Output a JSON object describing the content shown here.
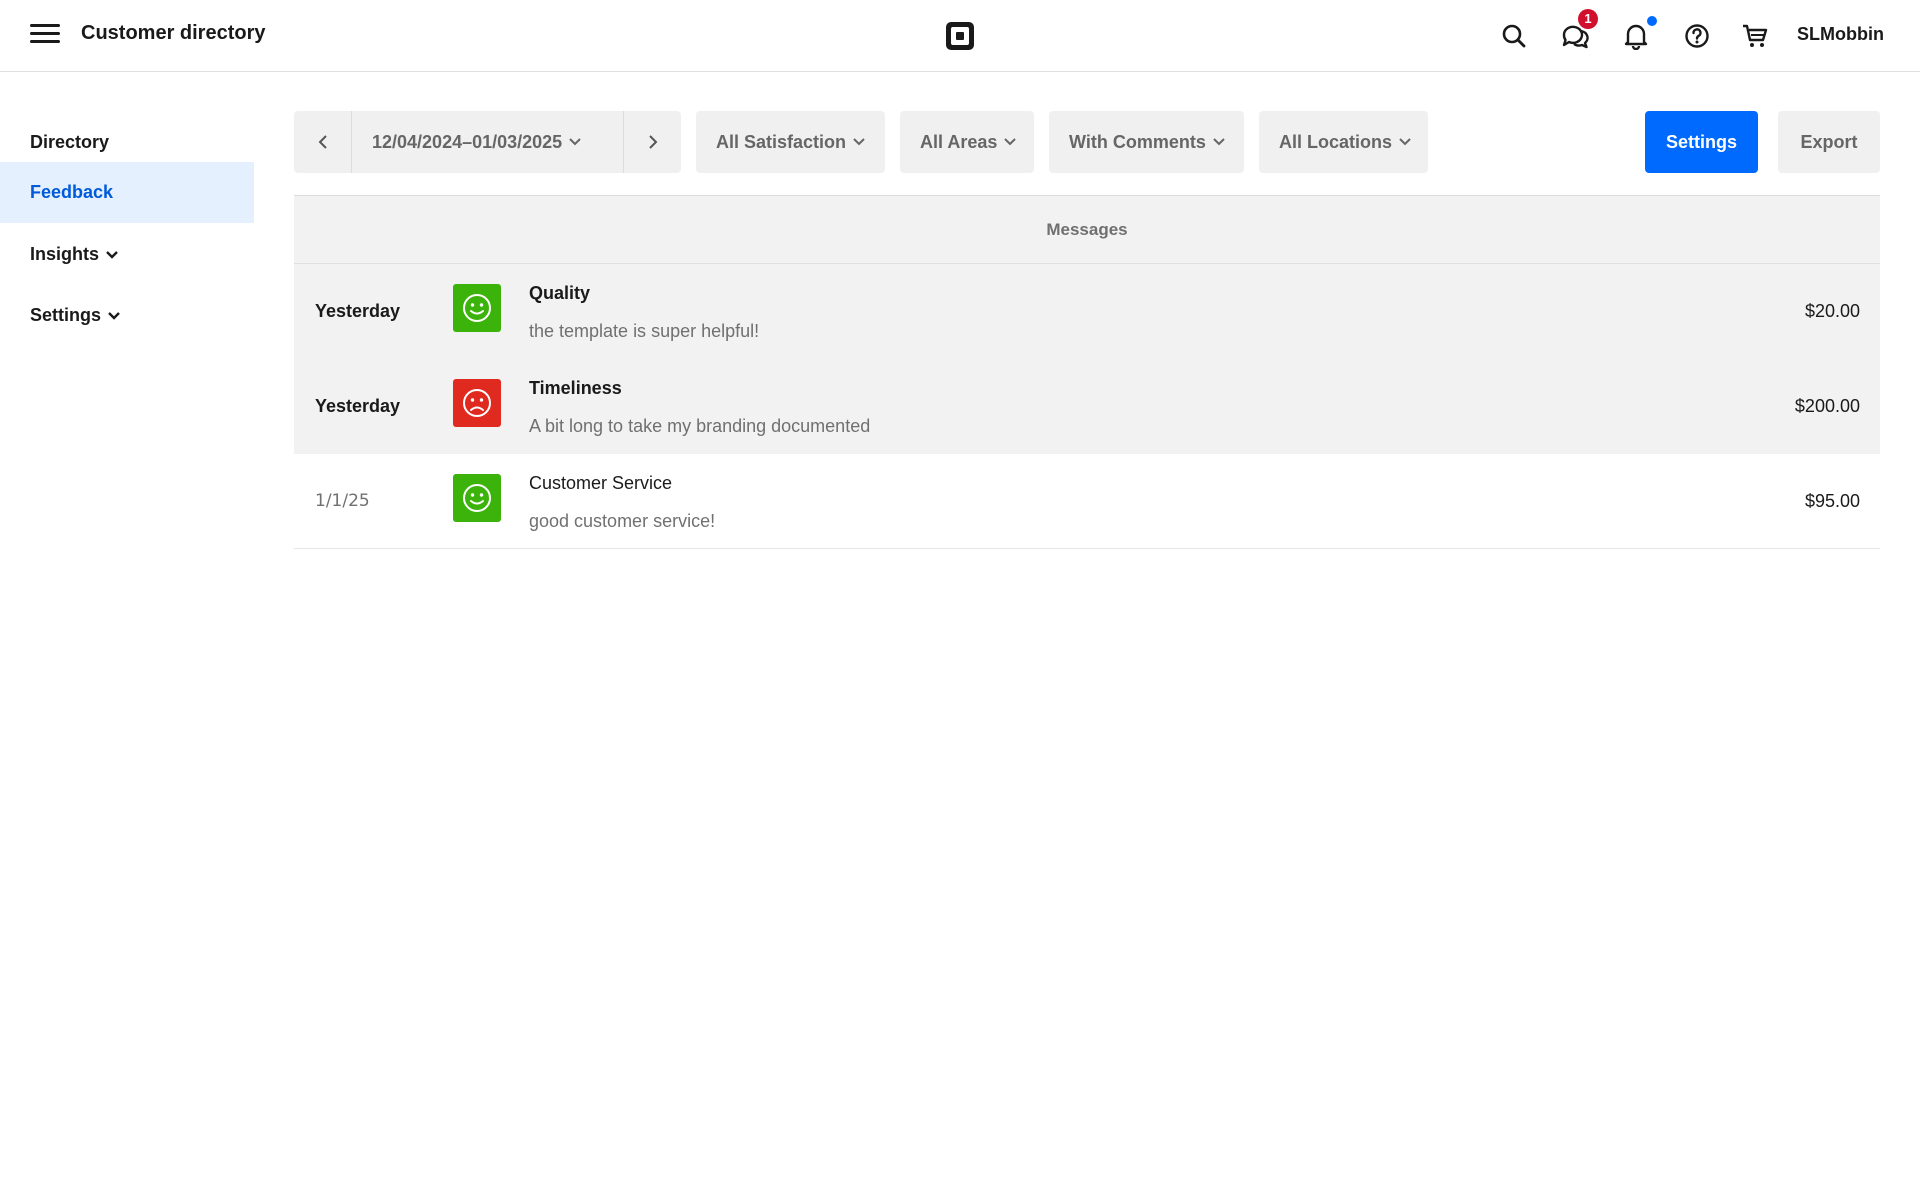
{
  "header": {
    "title": "Customer directory",
    "messages_badge": "1",
    "username": "SLMobbin"
  },
  "sidebar": {
    "items": [
      {
        "label": "Directory",
        "active": false,
        "expandable": false
      },
      {
        "label": "Feedback",
        "active": true,
        "expandable": false
      },
      {
        "label": "Insights",
        "active": false,
        "expandable": true
      },
      {
        "label": "Settings",
        "active": false,
        "expandable": true
      }
    ]
  },
  "toolbar": {
    "date_range": "12/04/2024–01/03/2025",
    "filters": {
      "satisfaction": "All Satisfaction",
      "areas": "All Areas",
      "comments": "With Comments",
      "locations": "All Locations"
    },
    "settings_label": "Settings",
    "export_label": "Export"
  },
  "table": {
    "header": "Messages",
    "rows": [
      {
        "date": "Yesterday",
        "sentiment": "positive",
        "category": "Quality",
        "message": "the template is super helpful!",
        "amount": "$20.00",
        "unread": true
      },
      {
        "date": "Yesterday",
        "sentiment": "negative",
        "category": "Timeliness",
        "message": "A bit long to take my branding documented",
        "amount": "$200.00",
        "unread": true
      },
      {
        "date": "1/1/25",
        "sentiment": "positive",
        "category": "Customer Service",
        "message": "good customer service!",
        "amount": "$95.00",
        "unread": false
      }
    ]
  },
  "colors": {
    "accent": "#006aff",
    "active_nav_bg": "#e5f0ff",
    "active_nav_text": "#005ad9",
    "positive": "#3cb30a",
    "negative": "#e02a1f",
    "badge": "#d0102c"
  },
  "icons": [
    "menu-icon",
    "square-logo",
    "search-icon",
    "messages-icon",
    "bell-icon",
    "help-icon",
    "cart-icon",
    "chevron-left-icon",
    "chevron-right-icon",
    "chevron-down-icon",
    "smiley-face-icon",
    "frown-face-icon"
  ]
}
